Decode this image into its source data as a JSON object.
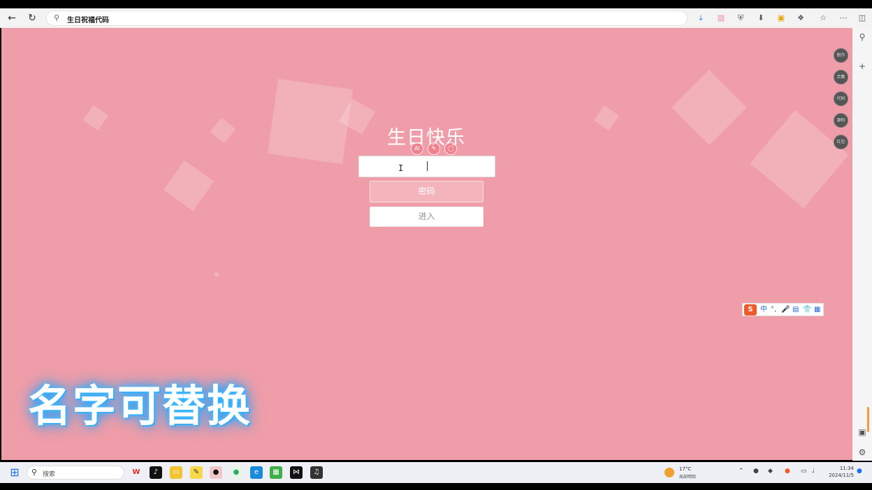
{
  "browser": {
    "address_text": "生日祝福代码",
    "nav": {
      "back": "←",
      "reload": "↻"
    },
    "toolbar_icons": [
      "download-icon",
      "collection-icon",
      "shield-icon",
      "save-icon",
      "extension-icon",
      "puzzle-icon",
      "favorites-icon",
      "more-icon",
      "sidebar-icon"
    ]
  },
  "page": {
    "background": "#ef9da8",
    "title": "生日快乐",
    "mini_icons": [
      "AI",
      "✎",
      "◯"
    ],
    "name_input_value": "",
    "password_button": "密码",
    "enter_button": "进入",
    "side_buttons": [
      "制作",
      "合集",
      "代码",
      "源码",
      "红包"
    ]
  },
  "ime": {
    "logo": "S",
    "items": [
      "中",
      "°,",
      "🎤",
      "▤",
      "👕",
      "▦"
    ]
  },
  "overlay_caption": "名字可替换",
  "taskbar": {
    "search_label": "搜索",
    "weather_temp": "17°C",
    "weather_desc": "局部晴朗",
    "time": "11:34",
    "date": "2024/11/5"
  }
}
